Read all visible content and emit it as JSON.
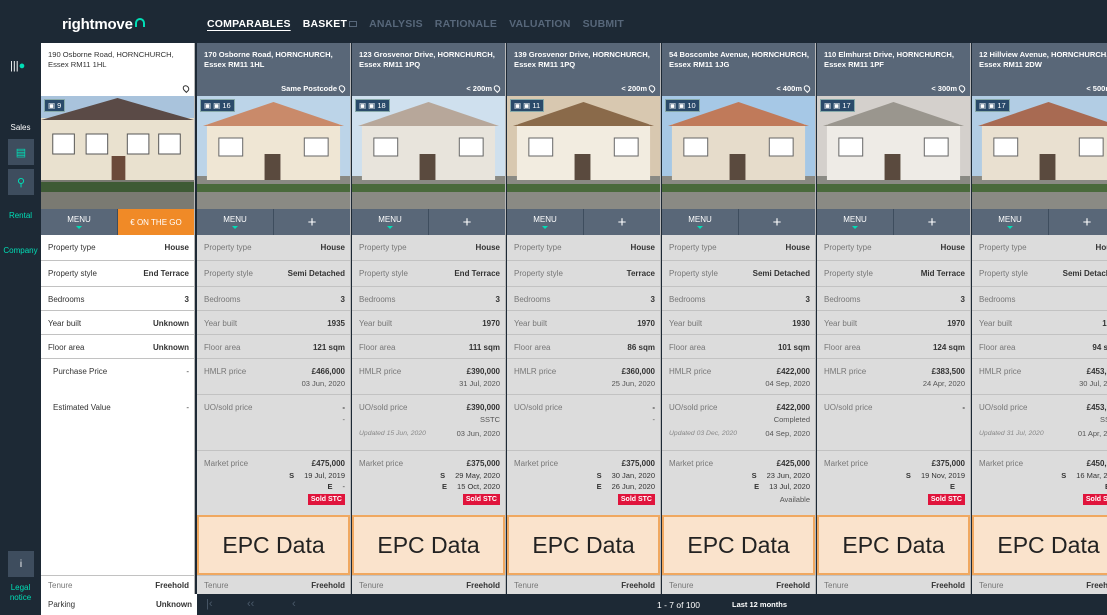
{
  "app": {
    "logo": "rightmove"
  },
  "nav": {
    "tabs": [
      "COMPARABLES",
      "BASKET",
      "ANALYSIS",
      "RATIONALE",
      "VALUATION",
      "SUBMIT"
    ]
  },
  "sidebar": {
    "sales": "Sales",
    "rental": "Rental",
    "company": "Company",
    "info": "i",
    "legal_line1": "Legal",
    "legal_line2": "notice"
  },
  "labels": {
    "menu": "MENU",
    "on_the_go": "ON THE GO",
    "plus": "+",
    "property_type": "Property type",
    "property_style": "Property style",
    "bedrooms": "Bedrooms",
    "year_built": "Year built",
    "floor_area": "Floor area",
    "purchase_price": "Purchase Price",
    "estimated_value": "Estimated Value",
    "hmlr_price": "HMLR price",
    "uo_sold_price": "UO/sold price",
    "market_price": "Market price",
    "tenure": "Tenure",
    "parking": "Parking",
    "epc": "EPC Data",
    "sold_stc": "Sold STC",
    "s": "S",
    "e": "E",
    "dash": "-"
  },
  "subject": {
    "address": "190 Osborne Road, HORNCHURCH, Essex RM11 1HL",
    "photo_count": "9",
    "property_type": "House",
    "property_style": "End Terrace",
    "bedrooms": "3",
    "year_built": "Unknown",
    "floor_area": "Unknown",
    "purchase_price": "-",
    "estimated_value": "-",
    "tenure": "Freehold",
    "parking": "Unknown"
  },
  "comparables": [
    {
      "address": "170 Osborne Road, HORNCHURCH, Essex RM11 1HL",
      "distance": "Same Postcode",
      "photo_count": "16",
      "property_type": "House",
      "property_style": "Semi Detached",
      "bedrooms": "3",
      "year_built": "1935",
      "floor_area": "121 sqm",
      "hmlr_price": "£466,000",
      "hmlr_date": "03 Jun, 2020",
      "uo_price": "-",
      "uo_status": "-",
      "uo_date": "",
      "updated": "",
      "market_price": "£475,000",
      "s_date": "19 Jul, 2019",
      "e_date": "-",
      "status": "Sold STC",
      "tenure": "Freehold"
    },
    {
      "address": "123 Grosvenor Drive, HORNCHURCH, Essex RM11 1PQ",
      "distance": "< 200m",
      "photo_count": "18",
      "property_type": "House",
      "property_style": "End Terrace",
      "bedrooms": "3",
      "year_built": "1970",
      "floor_area": "111 sqm",
      "hmlr_price": "£390,000",
      "hmlr_date": "31 Jul, 2020",
      "uo_price": "£390,000",
      "uo_status": "SSTC",
      "uo_date": "03 Jun, 2020",
      "updated": "Updated 15 Jun, 2020",
      "market_price": "£375,000",
      "s_date": "29 May, 2020",
      "e_date": "15 Oct, 2020",
      "status": "Sold STC",
      "tenure": "Freehold"
    },
    {
      "address": "139 Grosvenor Drive, HORNCHURCH, Essex RM11 1PQ",
      "distance": "< 200m",
      "photo_count": "11",
      "property_type": "House",
      "property_style": "Terrace",
      "bedrooms": "3",
      "year_built": "1970",
      "floor_area": "86 sqm",
      "hmlr_price": "£360,000",
      "hmlr_date": "25 Jun, 2020",
      "uo_price": "-",
      "uo_status": "-",
      "uo_date": "",
      "updated": "",
      "market_price": "£375,000",
      "s_date": "30 Jan, 2020",
      "e_date": "26 Jun, 2020",
      "status": "Sold STC",
      "tenure": "Freehold"
    },
    {
      "address": "54 Boscombe Avenue, HORNCHURCH, Essex RM11 1JG",
      "distance": "< 400m",
      "photo_count": "10",
      "property_type": "House",
      "property_style": "Semi Detached",
      "bedrooms": "3",
      "year_built": "1930",
      "floor_area": "101 sqm",
      "hmlr_price": "£422,000",
      "hmlr_date": "04 Sep, 2020",
      "uo_price": "£422,000",
      "uo_status": "Completed",
      "uo_date": "04 Sep, 2020",
      "updated": "Updated 03 Dec, 2020",
      "market_price": "£425,000",
      "s_date": "23 Jun, 2020",
      "e_date": "13 Jul, 2020",
      "status": "Available",
      "tenure": "Freehold"
    },
    {
      "address": "110 Elmhurst Drive, HORNCHURCH, Essex RM11 1PF",
      "distance": "< 300m",
      "photo_count": "17",
      "property_type": "House",
      "property_style": "Mid Terrace",
      "bedrooms": "3",
      "year_built": "1970",
      "floor_area": "124 sqm",
      "hmlr_price": "£383,500",
      "hmlr_date": "24 Apr, 2020",
      "uo_price": "-",
      "uo_status": "",
      "uo_date": "",
      "updated": "",
      "market_price": "£375,000",
      "s_date": "19 Nov, 2019",
      "e_date": "",
      "status": "Sold STC",
      "tenure": "Freehold"
    },
    {
      "address": "12 Hillview Avenue, HORNCHURCH, Essex RM11 2DW",
      "distance": "< 500m",
      "photo_count": "17",
      "property_type": "House",
      "property_style": "Semi Detached",
      "bedrooms": "3",
      "year_built": "1930",
      "floor_area": "94 sqm",
      "hmlr_price": "£453,000",
      "hmlr_date": "30 Jul, 2020",
      "uo_price": "£453,000",
      "uo_status": "SSTC",
      "uo_date": "01 Apr, 2020",
      "updated": "Updated 31 Jul, 2020",
      "market_price": "£450,000",
      "s_date": "16 Mar, 2020",
      "e_date": "",
      "status": "Sold STC",
      "tenure": "Freehold"
    }
  ],
  "footer": {
    "page_count": "1 - 7 of 100",
    "period": "Last 12 months"
  },
  "colors": {
    "dark": "#1d2935",
    "accent": "#00deb6",
    "orange": "#f08a27",
    "sold": "#e0143c",
    "header_grey": "#596778"
  }
}
